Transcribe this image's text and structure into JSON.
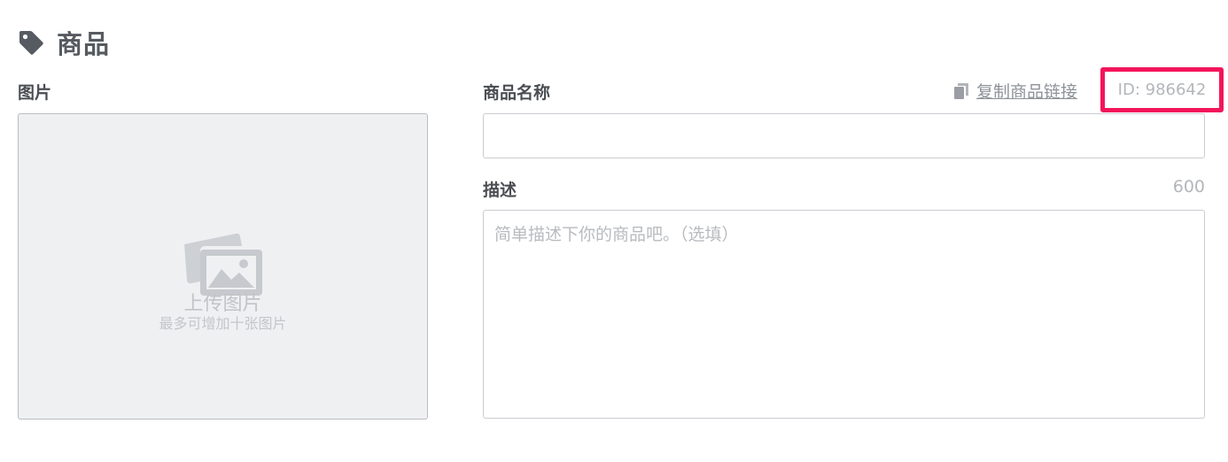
{
  "section": {
    "title": "商品",
    "icon": "tag-icon"
  },
  "image": {
    "label": "图片",
    "upload_title": "上传图片",
    "upload_hint": "最多可增加十张图片",
    "icon": "image-upload-icon"
  },
  "product_name": {
    "label": "商品名称",
    "value": "",
    "placeholder": ""
  },
  "copy_link": {
    "label": "复制商品链接",
    "icon": "copy-icon"
  },
  "product_id": {
    "text": "ID: 986642",
    "highlight_color": "#f3155b"
  },
  "description": {
    "label": "描述",
    "char_limit": "600",
    "placeholder": "简单描述下你的商品吧。（选填）",
    "value": ""
  }
}
